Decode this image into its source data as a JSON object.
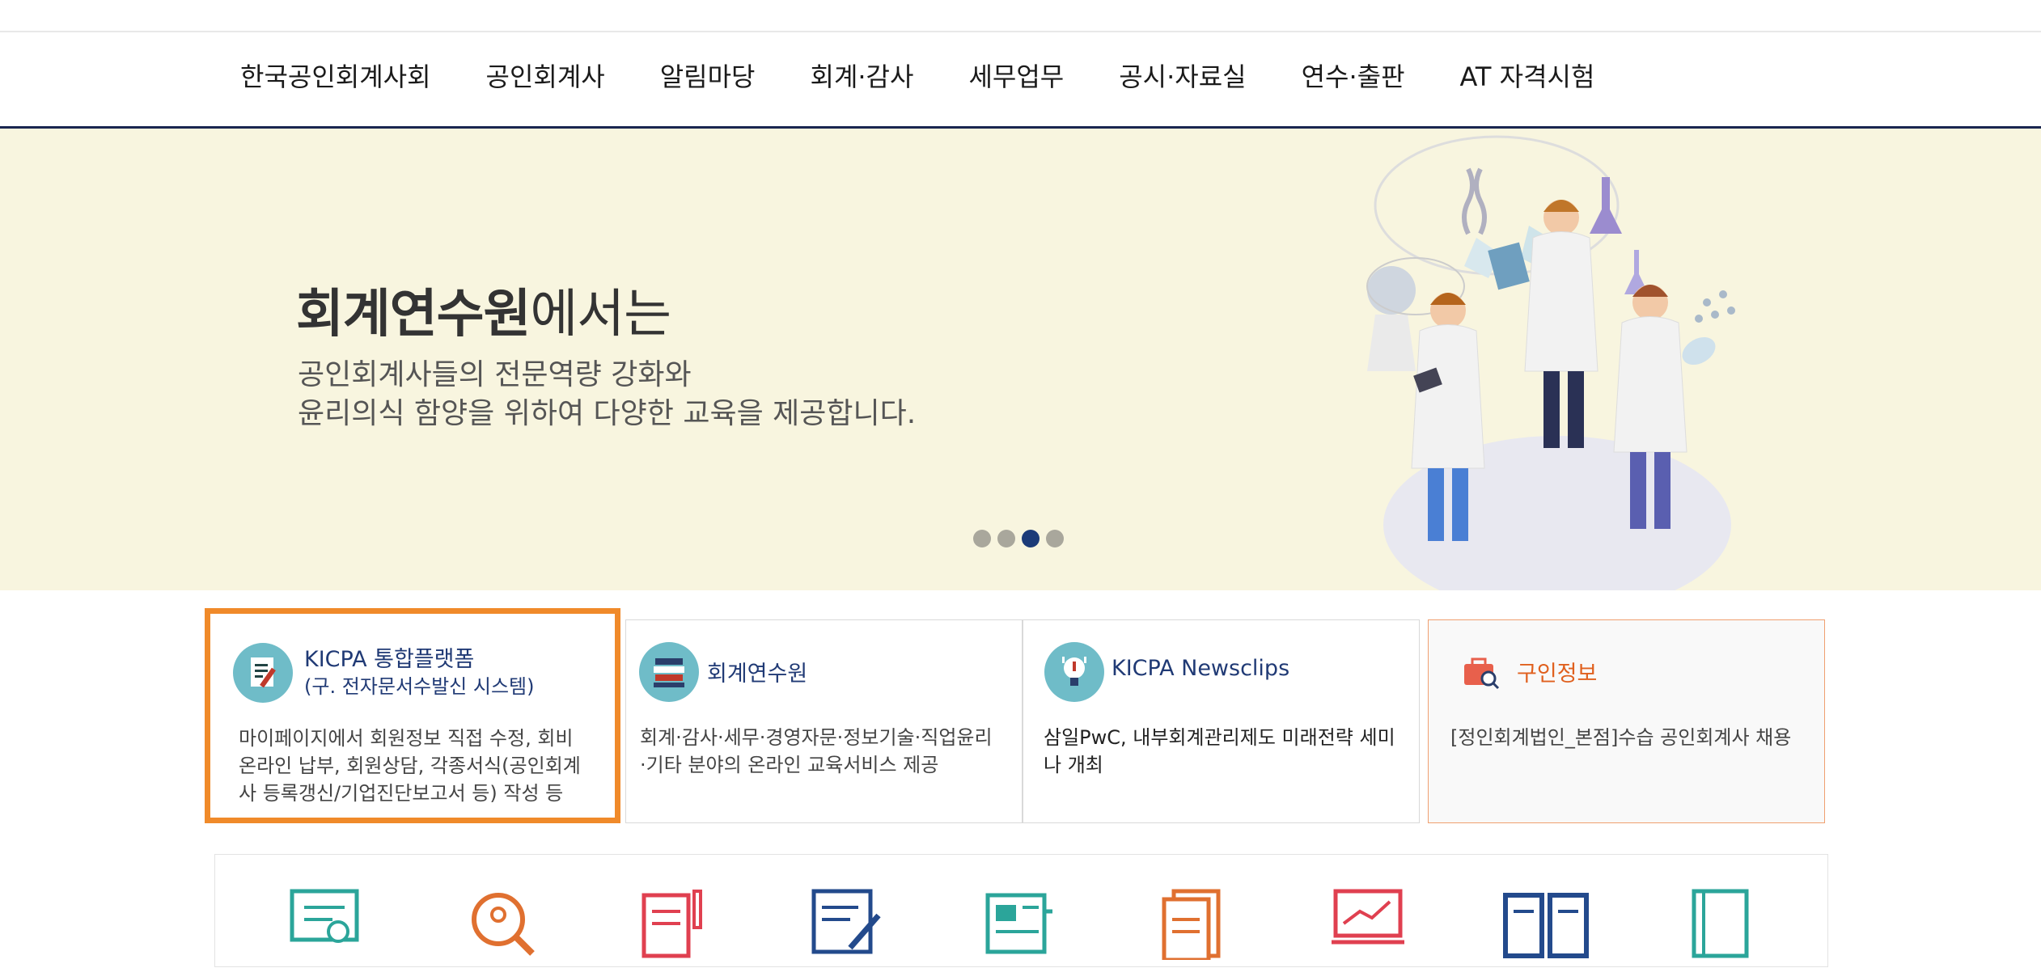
{
  "nav": [
    "한국공인회계사회",
    "공인회계사",
    "알림마당",
    "회계·감사",
    "세무업무",
    "공시·자료실",
    "연수·출판",
    "AT 자격시험"
  ],
  "hero": {
    "title_bold": "회계연수원",
    "title_light": "에서는",
    "line1": "공인회계사들의 전문역량 강화와",
    "line2": "윤리의식 함양을 위하여 다양한 교육을 제공합니다.",
    "slide_count": 4,
    "active_slide": 3
  },
  "cards": [
    {
      "title1": "KICPA 통합플랫폼",
      "title2": "(구. 전자문서수발신 시스템)",
      "desc": "마이페이지에서 회원정보 직접 수정, 회비 온라인 납부, 회원상담, 각종서식(공인회계사 등록갱신/기업진단보고서 등) 작성 등",
      "icon": "document-pen-icon"
    },
    {
      "title1": "회계연수원",
      "desc": "회계·감사·세무·경영자문·정보기술·직업윤리·기타 분야의 온라인 교육서비스 제공",
      "icon": "books-icon"
    },
    {
      "title1": "KICPA Newsclips",
      "desc": "삼일PwC, 내부회계관리제도 미래전략 세미나 개최",
      "icon": "lightbulb-icon"
    },
    {
      "title1": "구인정보",
      "desc": "[정인회계법인_본점]수습 공인회계사 채용",
      "icon": "briefcase-search-icon"
    }
  ],
  "colors": {
    "nav_border": "#1a2650",
    "hero_bg": "#f8f5df",
    "highlight": "#f08a2a",
    "card_title": "#203a75",
    "job_title": "#e0601e",
    "icon_circle": "#6fbcc8"
  },
  "quick_icons": [
    "certificate-icon",
    "search-person-icon",
    "document-pen-icon",
    "notepad-pen-icon",
    "newspaper-icon",
    "documents-icon",
    "monitor-chart-icon",
    "open-book-icon",
    "book-icon"
  ]
}
